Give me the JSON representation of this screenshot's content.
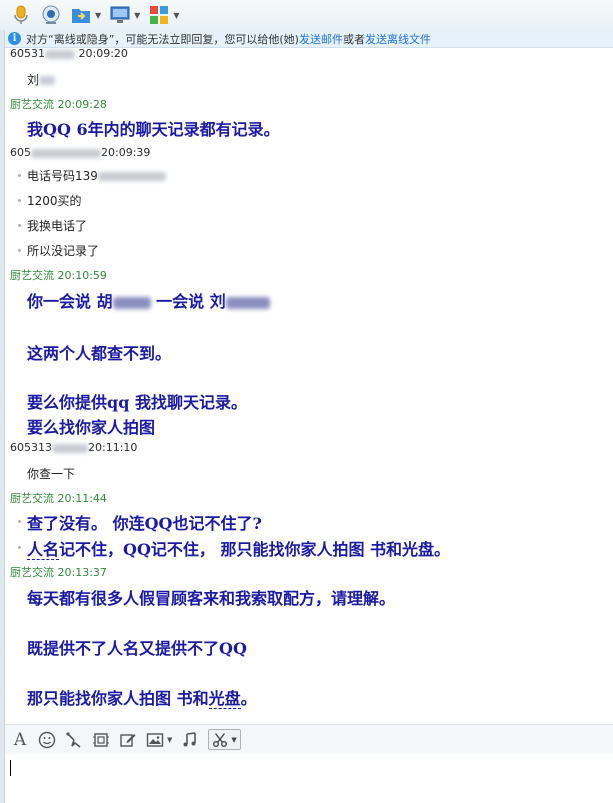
{
  "notice": {
    "text_before": "对方“离线或隐身”，可能无法立即回复，您可以给他(她)",
    "link_email": "发送邮件",
    "text_mid": "或者",
    "link_file": "发送离线文件"
  },
  "messages": {
    "m1_header_prefix": "60531",
    "m1_header_time": "20:09:20",
    "m1_line": "刘",
    "m2_header": "厨艺交流  20:09:28",
    "m2_line": "我QQ 6年内的聊天记录都有记录。",
    "m3_header_prefix": "605",
    "m3_header_time": "20:09:39",
    "m3_lines": [
      "电话号码139",
      "1200买的",
      "我换电话了",
      "所以没记录了"
    ],
    "m4_header": "厨艺交流  20:10:59",
    "m4_l1a": "你一会说  胡",
    "m4_l1b": "一会说  刘",
    "m4_l2": "这两个人都查不到。",
    "m4_l3": "要么你提供qq 我找聊天记录。",
    "m4_l4": "要么找你家人拍图",
    "m5_header_prefix": "605313",
    "m5_header_time": "20:11:10",
    "m5_line": "你查一下",
    "m6_header": "厨艺交流  20:11:44",
    "m6_l1": "查了没有。   你连QQ也记不住了?",
    "m6_l2a": "人名",
    "m6_l2b": "记不住，QQ记不住，    那只能找你家人拍图  书和光盘。",
    "m7_header": "厨艺交流  20:13:37",
    "m7_l1": "每天都有很多人假冒顾客来和我索取配方，请理解。",
    "m7_l2": "既提供不了人名又提供不了QQ",
    "m7_l3a": "那只能找你家人拍图  书和",
    "m7_l3b": "光盘",
    "m7_l3c": "。"
  },
  "colors": {
    "me_header": "#2e8b3a",
    "bold_text": "#1a1aa6",
    "link": "#1d73d6"
  }
}
